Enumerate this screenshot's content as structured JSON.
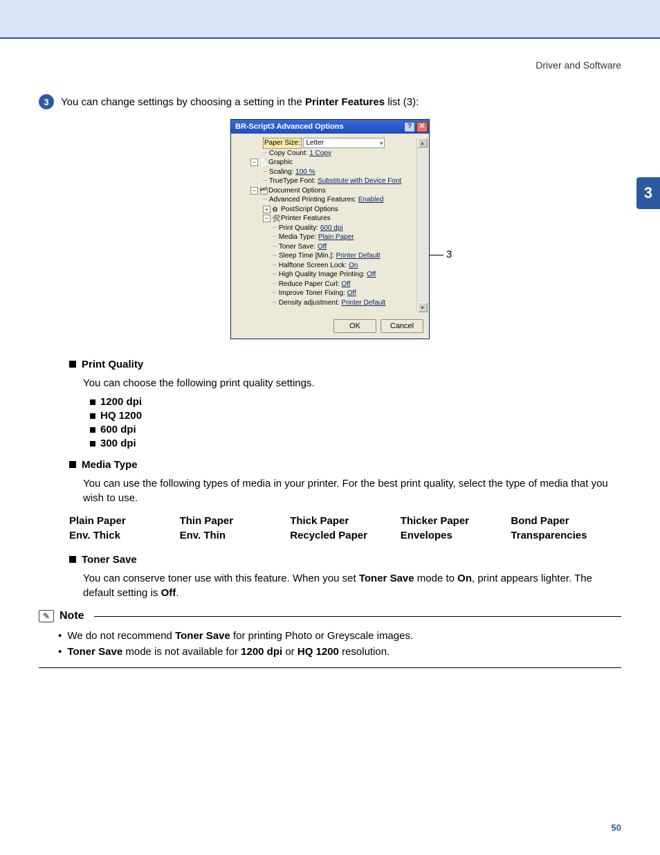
{
  "header": {
    "section": "Driver and Software"
  },
  "side_tab": "3",
  "page_number": "50",
  "step": {
    "num": "3",
    "text_before": "You can change settings by choosing a setting in the ",
    "text_bold": "Printer Features",
    "text_after": " list (3):"
  },
  "dialog": {
    "title": "BR-Script3 Advanced Options",
    "help": "?",
    "close": "✕",
    "paper_size_label": "Paper Size:",
    "paper_size_value": "Letter",
    "copy_count_label": "Copy Count:",
    "copy_count_value": "1 Copy",
    "graphic_label": "Graphic",
    "scaling_label": "Scaling:",
    "scaling_value": "100 %",
    "ttfont_label": "TrueType Font:",
    "ttfont_value": "Substitute with Device Font",
    "docopt_label": "Document Options",
    "apf_label": "Advanced Printing Features:",
    "apf_value": "Enabled",
    "psopt_label": "PostScript Options",
    "pf_label": "Printer Features",
    "pq_label": "Print Quality:",
    "pq_value": "600 dpi",
    "mt_label": "Media Type:",
    "mt_value": "Plain Paper",
    "ts_label": "Toner Save:",
    "ts_value": "Off",
    "st_label": "Sleep Time [Min.]:",
    "st_value": "Printer Default",
    "hs_label": "Halftone Screen Lock:",
    "hs_value": "On",
    "hq_label": "High Quality Image Printing:",
    "hq_value": "Off",
    "rp_label": "Reduce Paper Curl:",
    "rp_value": "Off",
    "it_label": "Improve Toner Fixing:",
    "it_value": "Off",
    "da_label": "Density adjustment:",
    "da_value": "Printer Default",
    "ok": "OK",
    "cancel": "Cancel",
    "callout": "3"
  },
  "sections": {
    "print_quality": {
      "title": "Print Quality",
      "desc": "You can choose the following print quality settings.",
      "items": [
        "1200 dpi",
        "HQ 1200",
        "600 dpi",
        "300 dpi"
      ]
    },
    "media_type": {
      "title": "Media Type",
      "desc": "You can use the following types of media in your printer. For the best print quality, select the type of media that you wish to use.",
      "grid": [
        "Plain Paper",
        "Thin Paper",
        "Thick Paper",
        "Thicker Paper",
        "Bond Paper",
        "Env. Thick",
        "Env. Thin",
        "Recycled Paper",
        "Envelopes",
        "Transparencies"
      ]
    },
    "toner_save": {
      "title": "Toner Save",
      "p1a": "You can conserve toner use with this feature. When you set ",
      "p1b": "Toner Save",
      "p1c": " mode to ",
      "p1d": "On",
      "p1e": ", print appears lighter. The default setting is ",
      "p1f": "Off",
      "p1g": "."
    }
  },
  "note": {
    "title": "Note",
    "l1a": "We do not recommend ",
    "l1b": "Toner Save",
    "l1c": " for printing Photo or Greyscale images.",
    "l2a": "Toner Save",
    "l2b": " mode is not available for ",
    "l2c": "1200 dpi",
    "l2d": " or ",
    "l2e": "HQ 1200",
    "l2f": " resolution."
  }
}
